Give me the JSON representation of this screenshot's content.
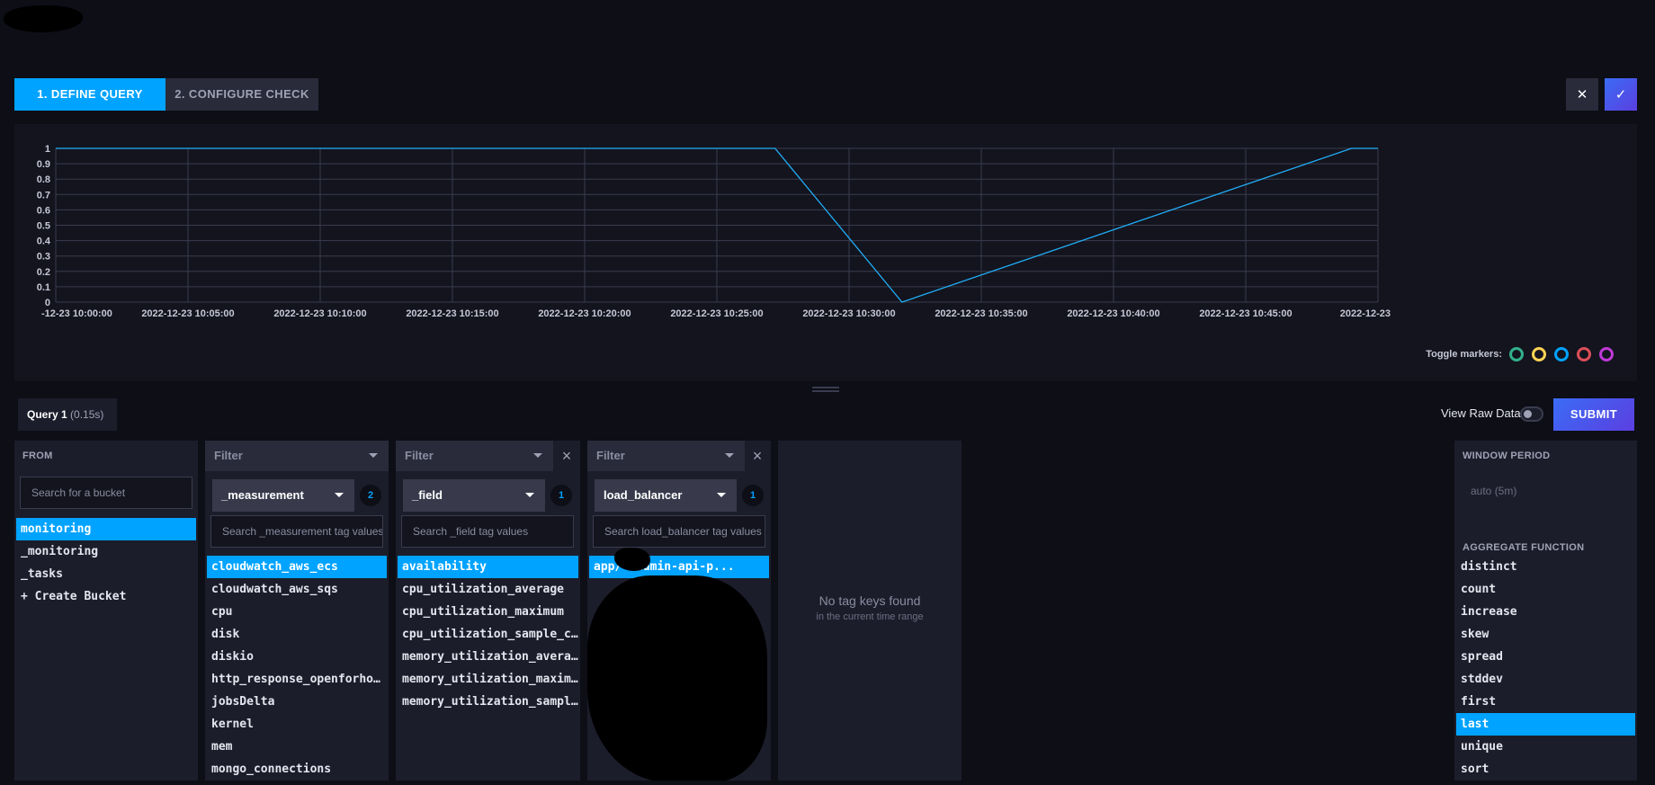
{
  "tabs": {
    "define_query": "1. DEFINE QUERY",
    "configure_check": "2. CONFIGURE CHECK"
  },
  "header_buttons": {
    "close": "✕",
    "confirm": "✓"
  },
  "chart_data": {
    "type": "line",
    "y_ticks": [
      "0",
      "0.1",
      "0.2",
      "0.3",
      "0.4",
      "0.5",
      "0.6",
      "0.7",
      "0.8",
      "0.9",
      "1"
    ],
    "x_ticks": [
      "-12-23 10:00:00",
      "2022-12-23 10:05:00",
      "2022-12-23 10:10:00",
      "2022-12-23 10:15:00",
      "2022-12-23 10:20:00",
      "2022-12-23 10:25:00",
      "2022-12-23 10:30:00",
      "2022-12-23 10:35:00",
      "2022-12-23 10:40:00",
      "2022-12-23 10:45:00",
      "2022-12-23"
    ],
    "ylim": [
      0,
      1
    ],
    "xlim_minutes": [
      0,
      50
    ],
    "grid": true,
    "series": [
      {
        "color": "#22adf6",
        "x": [
          0,
          27.2,
          32,
          49,
          50
        ],
        "y": [
          1,
          1,
          0,
          1,
          1
        ]
      }
    ]
  },
  "markers": {
    "label": "Toggle markers:",
    "colors": [
      "#32b08c",
      "#ffd255",
      "#00a3ff",
      "#dc4e58",
      "#bf3ad6"
    ]
  },
  "query": {
    "name": "Query 1",
    "time": "(0.15s)"
  },
  "raw_data_label": "View Raw Data",
  "submit_label": "SUBMIT",
  "from_panel": {
    "title": "FROM",
    "search_placeholder": "Search for a bucket",
    "buckets": [
      "monitoring",
      "_monitoring",
      "_tasks",
      "+ Create Bucket"
    ]
  },
  "measurement_panel": {
    "filter_label": "Filter",
    "key": "_measurement",
    "count": "2",
    "search_placeholder": "Search _measurement tag values",
    "values": [
      "cloudwatch_aws_ecs",
      "cloudwatch_aws_sqs",
      "cpu",
      "disk",
      "diskio",
      "http_response_openforhom...",
      "jobsDelta",
      "kernel",
      "mem",
      "mongo_connections"
    ]
  },
  "field_panel": {
    "filter_label": "Filter",
    "key": "_field",
    "count": "1",
    "search_placeholder": "Search _field tag values",
    "values": [
      "availability",
      "cpu_utilization_average",
      "cpu_utilization_maximum",
      "cpu_utilization_sample_c...",
      "memory_utilization_avera...",
      "memory_utilization_maxim...",
      "memory_utilization_sampl..."
    ]
  },
  "lb_panel": {
    "filter_label": "Filter",
    "key": "load_balancer",
    "count": "1",
    "search_placeholder": "Search load_balancer tag values",
    "values": [
      "app/ -admin-api-p..."
    ]
  },
  "empty_panel": {
    "message": "No tag keys found",
    "sub": "in the current time range"
  },
  "aggregate_panel": {
    "window_title": "WINDOW PERIOD",
    "window_value": "auto (5m)",
    "agg_title": "AGGREGATE FUNCTION",
    "functions": [
      "distinct",
      "count",
      "increase",
      "skew",
      "spread",
      "stddev",
      "first",
      "last",
      "unique",
      "sort"
    ],
    "selected": "last"
  }
}
